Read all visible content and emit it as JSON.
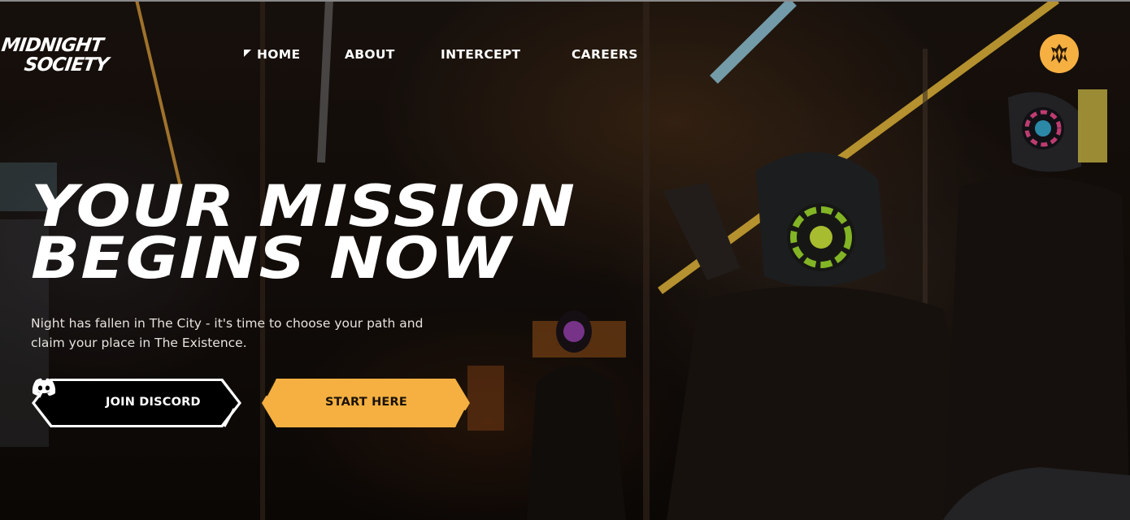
{
  "brand": {
    "logo_line1": "MIDNIGHT",
    "logo_line2": "SOCIETY",
    "accent_color": "#f5b041"
  },
  "nav": {
    "items": [
      {
        "label": "HOME",
        "active": true
      },
      {
        "label": "ABOUT",
        "active": false
      },
      {
        "label": "INTERCEPT",
        "active": false
      },
      {
        "label": "CAREERS",
        "active": false
      }
    ]
  },
  "header_emblem_icon": "society-emblem-icon",
  "hero": {
    "headline_line1": "YOUR MISSION",
    "headline_line2": "BEGINS NOW",
    "subtitle_line1": "Night has fallen in The City - it's time to choose your path and",
    "subtitle_line2": "claim your place in The Existence."
  },
  "buttons": {
    "discord_label": "JOIN DISCORD",
    "discord_icon": "discord-icon",
    "start_label": "START HERE"
  }
}
